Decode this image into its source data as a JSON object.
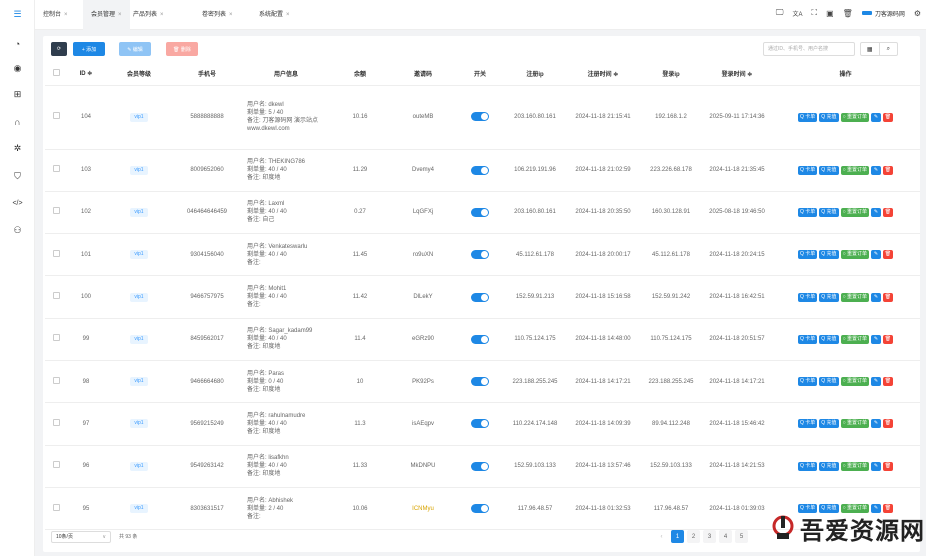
{
  "sidebar": {
    "icons": [
      "menu-icon",
      "dashboard-icon",
      "user-circle-icon",
      "gift-icon",
      "headset-icon",
      "gears-icon",
      "shield-icon",
      "code-icon",
      "users-icon"
    ]
  },
  "tabs": [
    {
      "label": "控制台",
      "close": "×"
    },
    {
      "label": "会员管理",
      "close": "×"
    },
    {
      "label": "产品列表",
      "close": "×"
    },
    {
      "label": "卷密列表",
      "close": "×"
    },
    {
      "label": "系统配置",
      "close": "×"
    }
  ],
  "header": {
    "icons": {
      "desktop": "🖵",
      "translate": "文A",
      "fullscreen": "⛶",
      "terminal": "▣",
      "trash": "🗑",
      "settings": "⚙"
    },
    "site_name": "刀客源码网"
  },
  "toolbar": {
    "refresh_icon": "⟳",
    "add": "+ 添加",
    "edit": "✎ 编辑",
    "delete": "🗑 删除"
  },
  "search": {
    "placeholder": "通过ID、手机号、用户名搜",
    "grid_icon": "▦",
    "search_icon": "⌕"
  },
  "table": {
    "headers": [
      "",
      "ID ≑",
      "会员等级",
      "手机号",
      "用户信息",
      "余额",
      "邀请码",
      "开关",
      "注册ip",
      "注册时间 ≑",
      "登录ip",
      "登录时间 ≑",
      "操作"
    ],
    "info_labels": {
      "username": "用户名:",
      "orders": "剩单量:",
      "remark": "备注:"
    },
    "ops": {
      "card": "Q 卡单",
      "recharge": "Q 充值",
      "reset": "○ 重置订单",
      "edit_icon": "✎",
      "delete_icon": "🗑"
    },
    "rows": [
      {
        "id": "104",
        "level": "vip1",
        "phone": "5888888888",
        "username": "dkewl",
        "orders": "5 / 40",
        "remark": "刀客源码网 演示站点",
        "remark2": "www.dkewl.com",
        "balance": "10.16",
        "invite": "outeMB",
        "reg_ip": "203.160.80.161",
        "reg_time": "2024-11-18 21:15:41",
        "login_ip": "192.168.1.2",
        "login_time": "2025-09-11 17:14:36"
      },
      {
        "id": "103",
        "level": "vip1",
        "phone": "8009652060",
        "username": "THEKING786",
        "orders": "40 / 40",
        "remark": "印度地",
        "remark2": "",
        "balance": "11.29",
        "invite": "Dvemy4",
        "reg_ip": "106.219.191.96",
        "reg_time": "2024-11-18 21:02:59",
        "login_ip": "223.226.68.178",
        "login_time": "2024-11-18 21:35:45"
      },
      {
        "id": "102",
        "level": "vip1",
        "phone": "046464646459",
        "username": "Laxml",
        "orders": "40 / 40",
        "remark": "自己",
        "remark2": "",
        "balance": "0.27",
        "invite": "LqGFXj",
        "reg_ip": "203.160.80.161",
        "reg_time": "2024-11-18 20:35:50",
        "login_ip": "160.30.128.91",
        "login_time": "2025-08-18 19:46:50"
      },
      {
        "id": "101",
        "level": "vip1",
        "phone": "9304156040",
        "username": "Venkateswarlu",
        "orders": "40 / 40",
        "remark": "",
        "remark2": "",
        "balance": "11.45",
        "invite": "ro9uXN",
        "reg_ip": "45.112.61.178",
        "reg_time": "2024-11-18 20:00:17",
        "login_ip": "45.112.61.178",
        "login_time": "2024-11-18 20:24:15"
      },
      {
        "id": "100",
        "level": "vip1",
        "phone": "9466757975",
        "username": "Mohit1",
        "orders": "40 / 40",
        "remark": "",
        "remark2": "",
        "balance": "11.42",
        "invite": "DlLekY",
        "reg_ip": "152.59.91.213",
        "reg_time": "2024-11-18 15:16:58",
        "login_ip": "152.59.91.242",
        "login_time": "2024-11-18 16:42:51"
      },
      {
        "id": "99",
        "level": "vip1",
        "phone": "8459562017",
        "username": "Sagar_kadam99",
        "orders": "40 / 40",
        "remark": "印度地",
        "remark2": "",
        "balance": "11.4",
        "invite": "eGRz90",
        "reg_ip": "110.75.124.175",
        "reg_time": "2024-11-18 14:48:00",
        "login_ip": "110.75.124.175",
        "login_time": "2024-11-18 20:51:57"
      },
      {
        "id": "98",
        "level": "vip1",
        "phone": "9466664680",
        "username": "Paras",
        "orders": "0 / 40",
        "remark": "印度地",
        "remark2": "",
        "balance": "10",
        "invite": "PK92Ps",
        "reg_ip": "223.188.255.245",
        "reg_time": "2024-11-18 14:17:21",
        "login_ip": "223.188.255.245",
        "login_time": "2024-11-18 14:17:21"
      },
      {
        "id": "97",
        "level": "vip1",
        "phone": "9569215249",
        "username": "rahulnamudre",
        "orders": "40 / 40",
        "remark": "印度地",
        "remark2": "",
        "balance": "11.3",
        "invite": "isAEqpv",
        "reg_ip": "110.224.174.148",
        "reg_time": "2024-11-18 14:09:39",
        "login_ip": "89.94.112.248",
        "login_time": "2024-11-18 15:46:42"
      },
      {
        "id": "96",
        "level": "vip1",
        "phone": "9549263142",
        "username": "lisafkhn",
        "orders": "40 / 40",
        "remark": "印度地",
        "remark2": "",
        "balance": "11.33",
        "invite": "MkDNPU",
        "reg_ip": "152.59.103.133",
        "reg_time": "2024-11-18 13:57:46",
        "login_ip": "152.59.103.133",
        "login_time": "2024-11-18 14:21:53"
      },
      {
        "id": "95",
        "level": "vip1",
        "phone": "8303631517",
        "username": "Abhishek",
        "orders": "2 / 40",
        "remark": "",
        "remark2": "",
        "balance": "10.06",
        "invite": "ICNMyu",
        "reg_ip": "117.96.48.57",
        "reg_time": "2024-11-18 01:32:53",
        "login_ip": "117.96.48.57",
        "login_time": "2024-11-18 01:39:03"
      }
    ]
  },
  "footer": {
    "page_size": "10条/页",
    "page_size_arrow": "∨",
    "total": "共 93 条",
    "prev": "‹",
    "pages": [
      "1",
      "2",
      "3",
      "4",
      "5"
    ]
  },
  "watermark": {
    "text": "吾爱资源网"
  },
  "colors": {
    "primary": "#1e88e5",
    "success": "#4caf50",
    "danger": "#f44336"
  }
}
